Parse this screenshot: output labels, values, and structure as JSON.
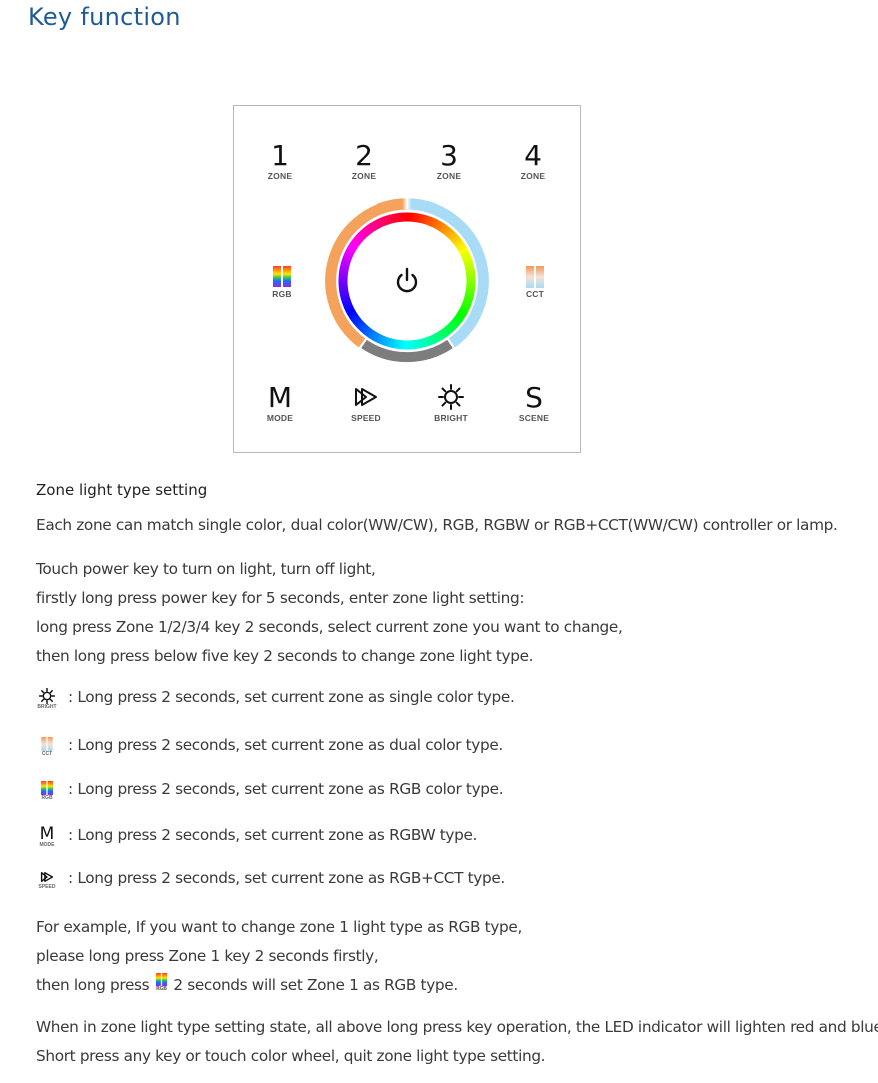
{
  "header": {
    "title": "Key function"
  },
  "panel": {
    "zones": [
      {
        "number": "1",
        "label": "ZONE"
      },
      {
        "number": "2",
        "label": "ZONE"
      },
      {
        "number": "3",
        "label": "ZONE"
      },
      {
        "number": "4",
        "label": "ZONE"
      }
    ],
    "rgb_key": {
      "label": "RGB",
      "icon": "rgb-bars-icon"
    },
    "cct_key": {
      "label": "CCT",
      "icon": "cct-bars-icon"
    },
    "power_key": {
      "icon": "power-icon"
    },
    "bottom_keys": [
      {
        "glyph": "M",
        "label": "MODE",
        "icon": "mode-icon"
      },
      {
        "glyph": "",
        "label": "SPEED",
        "icon": "speed-icon"
      },
      {
        "glyph": "",
        "label": "BRIGHT",
        "icon": "brightness-icon"
      },
      {
        "glyph": "S",
        "label": "SCENE",
        "icon": "scene-icon"
      }
    ],
    "colors": {
      "warm": "#f5a35c",
      "cool": "#a8dbf5",
      "gray": "#7d7d80",
      "border": "#b8b8b8"
    }
  },
  "section": {
    "heading": "Zone light type setting",
    "intro": "Each zone can match single color, dual color(WW/CW), RGB, RGBW or RGB+CCT(WW/CW) controller or lamp.",
    "steps": [
      "Touch power key to turn on light, turn off light,",
      "firstly long press power key for 5 seconds, enter zone light setting:",
      "long press Zone 1/2/3/4 key 2 seconds, select current zone you want to change,",
      "then long press below five key 2 seconds to change zone light type."
    ],
    "key_types": [
      {
        "icon_label": "BRIGHT",
        "text": ": Long press 2 seconds, set current zone as single color type."
      },
      {
        "icon_label": "CCT",
        "text": ": Long press 2 seconds, set current zone as dual color type."
      },
      {
        "icon_label": "RGB",
        "text": ": Long press 2 seconds, set current zone as RGB color type."
      },
      {
        "icon_label": "MODE",
        "glyph": "M",
        "text": ": Long press 2 seconds, set current zone as RGBW type."
      },
      {
        "icon_label": "SPEED",
        "text": ": Long press 2 seconds, set current zone as RGB+CCT type."
      }
    ],
    "example": {
      "line1": "For example, If you want to change zone 1 light type as RGB type,",
      "line2": "please long press Zone 1 key 2 seconds firstly,",
      "line3_before": "then long press",
      "line3_icon_label": "RGB",
      "line3_after": "2 seconds will set Zone 1 as RGB type."
    },
    "notes": [
      "When in zone light type setting state, all above long press key operation, the LED indicator will lighten red and blue.",
      "Short press any key or touch color wheel, quit zone light type setting."
    ]
  }
}
